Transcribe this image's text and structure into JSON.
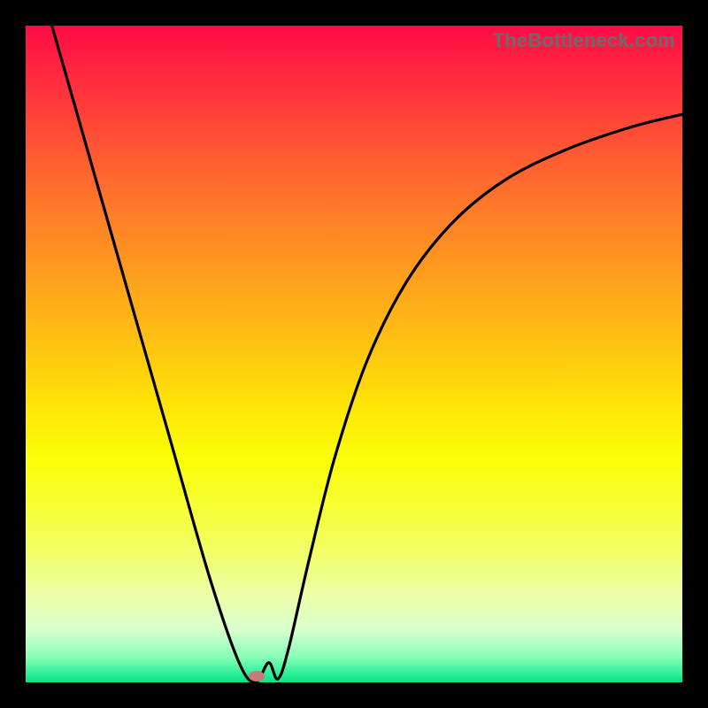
{
  "watermark": "TheBottleneck.com",
  "chart_data": {
    "type": "line",
    "title": "",
    "xlabel": "",
    "ylabel": "",
    "xlim": [
      0,
      100
    ],
    "ylim": [
      0,
      100
    ],
    "grid": false,
    "legend": false,
    "background": {
      "type": "vertical-gradient",
      "stops": [
        {
          "pos": 0.0,
          "color": "#ff0b45"
        },
        {
          "pos": 0.58,
          "color": "#ffe507"
        },
        {
          "pos": 1.0,
          "color": "#0be085"
        }
      ]
    },
    "series": [
      {
        "name": "bottleneck-curve",
        "color": "#000000",
        "x": [
          4,
          10,
          16,
          22,
          28,
          32.5,
          35,
          37,
          38.4,
          40,
          43,
          47,
          52,
          58,
          65,
          73,
          82,
          92,
          100
        ],
        "y": [
          100,
          79,
          58,
          37,
          16,
          3,
          0,
          3,
          0.5,
          5,
          18,
          34,
          49,
          61,
          70,
          76.5,
          81,
          84.5,
          86.5
        ]
      }
    ],
    "marker": {
      "x": 35.2,
      "y": 0.9,
      "color": "#c77a7a"
    }
  }
}
